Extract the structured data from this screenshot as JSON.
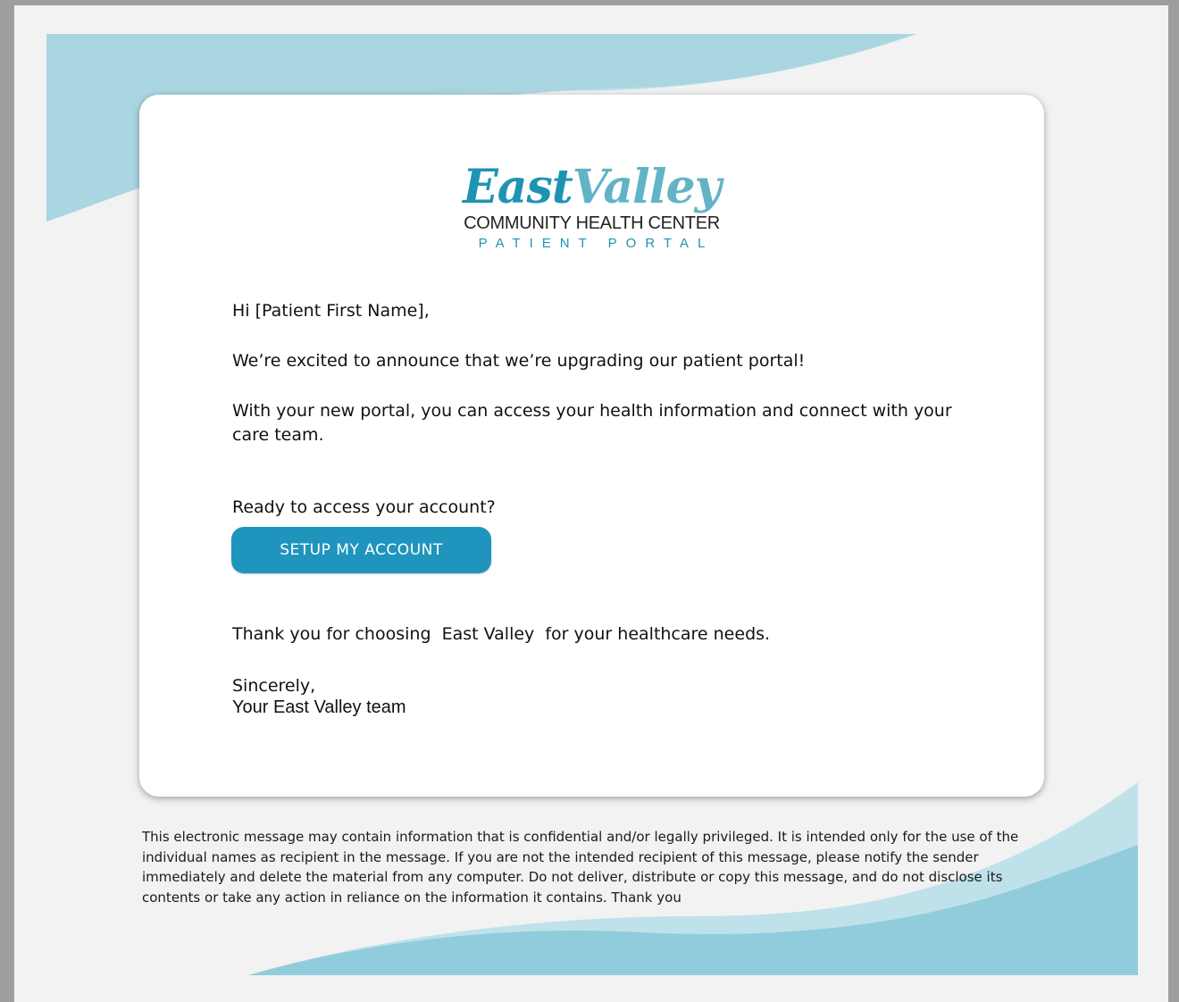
{
  "logo": {
    "word_part1": "East",
    "word_part2": "Valley",
    "subtitle": "COMMUNITY HEALTH CENTER",
    "portal": "PATIENT PORTAL"
  },
  "email": {
    "greeting": "Hi [Patient First Name],",
    "announcement": "We’re excited to announce that we’re upgrading our patient portal!",
    "features": "With your new portal, you can access your health information and connect with your care team.",
    "prompt": "Ready to access your account?",
    "cta_label": "SETUP MY ACCOUNT",
    "thanks": "Thank you for choosing  East Valley  for your healthcare needs.",
    "closing": "Sincerely,",
    "signature": "Your East Valley team"
  },
  "disclaimer": "This electronic message may contain information that is confidential and/or legally privileged. It is intended only for the use of the individual names as recipient in the message. If you are not the intended recipient of this message, please notify the sender immediately and delete the material from any computer. Do not deliver, distribute or copy this message, and do not disclose its contents or take any action in reliance on the information it contains. Thank you",
  "colors": {
    "brand_primary": "#1e93b4",
    "brand_secondary": "#62b3c6",
    "wave_light": "#a9d6e2",
    "wave_mid": "#8ccadb",
    "page_bg": "#f2f2f2"
  }
}
